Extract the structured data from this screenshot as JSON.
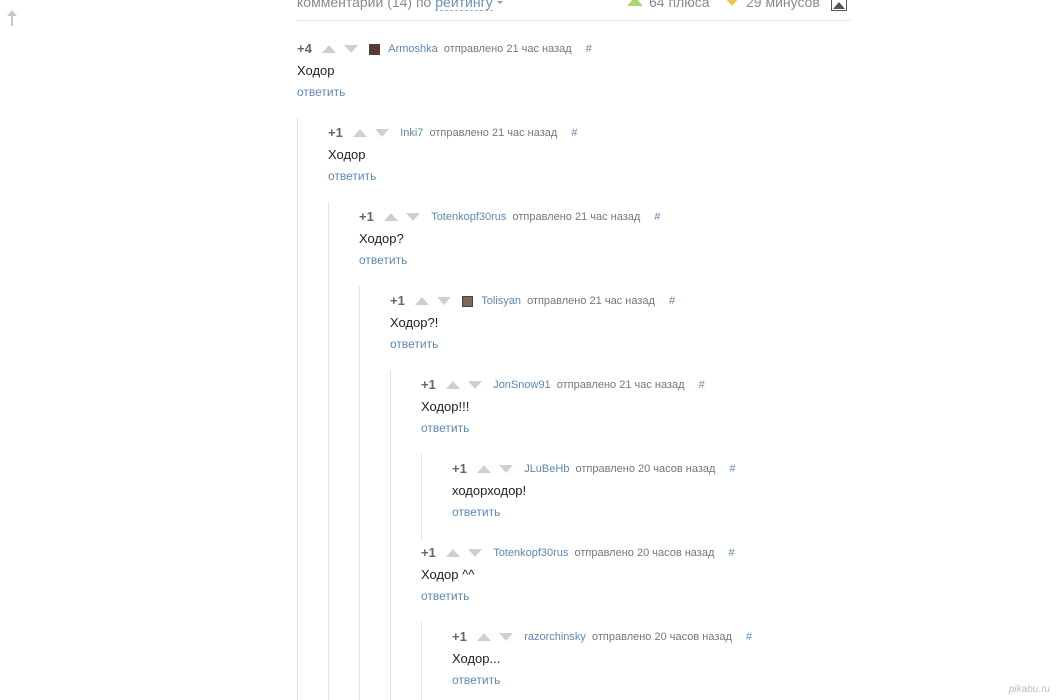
{
  "header": {
    "sort_text": "комментарии (14) по",
    "sort_value": "рейтингу",
    "pluses": "64 плюса",
    "minuses": "29 минусов",
    "image_icon": "image-icon",
    "plus_color": "#a8d86a",
    "minus_color": "#f2c34e"
  },
  "comments": [
    {
      "rating": "+4",
      "avatar": "avatar-icon",
      "author": "Armoshka",
      "meta": "отправлено 21 час назад",
      "hash": "#",
      "text": "Ходор",
      "reply": "ответить"
    },
    {
      "rating": "+1",
      "author": "Inki7",
      "meta": "отправлено 21 час назад",
      "hash": "#",
      "text": "Ходор",
      "reply": "ответить"
    },
    {
      "rating": "+1",
      "author": "Totenkopf30rus",
      "meta": "отправлено 21 час назад",
      "hash": "#",
      "text": "Ходор?",
      "reply": "ответить"
    },
    {
      "rating": "+1",
      "avatar": "avatar-icon",
      "author": "Tolisyan",
      "meta": "отправлено 21 час назад",
      "hash": "#",
      "text": "Ходор?!",
      "reply": "ответить"
    },
    {
      "rating": "+1",
      "author": "JonSnow91",
      "meta": "отправлено 21 час назад",
      "hash": "#",
      "text": "Ходор!!!",
      "reply": "ответить"
    },
    {
      "rating": "+1",
      "author": "JLuBeHb",
      "meta": "отправлено 20 часов назад",
      "hash": "#",
      "text": "ходорходор!",
      "reply": "ответить"
    },
    {
      "rating": "+1",
      "author": "Totenkopf30rus",
      "meta": "отправлено 20 часов назад",
      "hash": "#",
      "text": "Ходор ^^",
      "reply": "ответить"
    },
    {
      "rating": "+1",
      "author": "razorchinsky",
      "meta": "отправлено 20 часов назад",
      "hash": "#",
      "text": "Ходор...",
      "reply": "ответить"
    }
  ],
  "watermark": "pikabu.ru"
}
